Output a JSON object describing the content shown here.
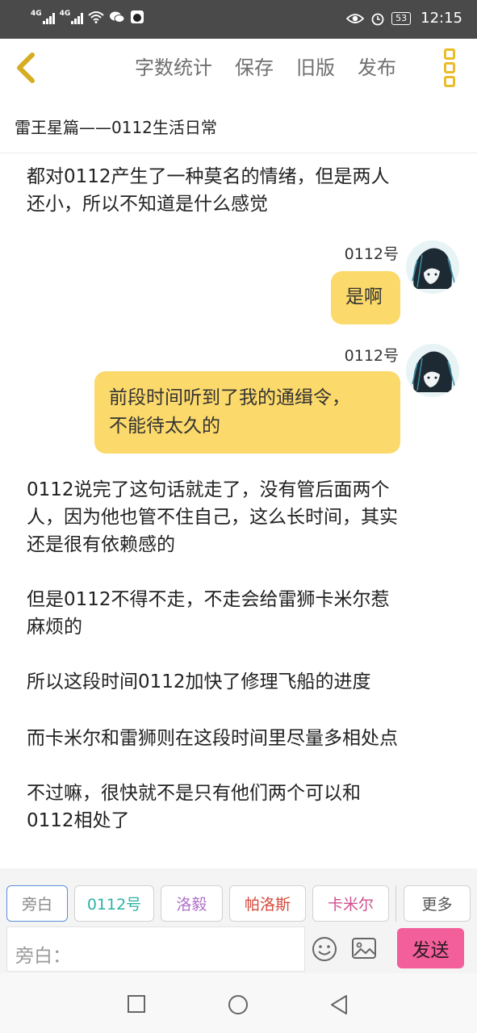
{
  "status_bar": {
    "signal1": "4G",
    "signal2": "4G",
    "battery": "53",
    "time": "12:15",
    "icons": [
      "signal-4g-icon",
      "wifi-icon",
      "wechat-icon",
      "app-icon",
      "eye-icon",
      "alarm-icon",
      "battery-icon"
    ]
  },
  "toolbar": {
    "back_icon": "chevron-left-icon",
    "word_count": "字数统计",
    "save": "保存",
    "old_version": "旧版",
    "publish": "发布",
    "more_icon": "more-vertical-icon"
  },
  "title": "雷王星篇——0112生活日常",
  "content": {
    "top_paragraph_lines": [
      "都对0112产生了一种莫名的情绪，但是两人",
      "还小，所以不知道是什么感觉"
    ],
    "messages": [
      {
        "speaker": "0112号",
        "text": "是啊"
      },
      {
        "speaker": "0112号",
        "text_lines": [
          "前段时间听到了我的通缉令，",
          "不能待太久的"
        ]
      }
    ],
    "paragraphs": [
      [
        "0112说完了这句话就走了，没有管后面两个",
        "人，因为他也管不住自己，这么长时间，其实",
        "还是很有依赖感的"
      ],
      [
        "但是0112不得不走，不走会给雷狮卡米尔惹",
        "麻烦的"
      ],
      [
        "所以这段时间0112加快了修理飞船的进度"
      ],
      [
        "而卡米尔和雷狮则在这段时间里尽量多相处点"
      ],
      [
        "不过嘛，很快就不是只有他们两个可以和",
        "0112相处了"
      ]
    ]
  },
  "characters": [
    {
      "label": "旁白",
      "color": "#8a8a8a"
    },
    {
      "label": "0112号",
      "color": "#2bb3a3"
    },
    {
      "label": "洛毅",
      "color": "#b071c9"
    },
    {
      "label": "帕洛斯",
      "color": "#d6493b"
    },
    {
      "label": "卡米尔",
      "color": "#d0508e"
    },
    {
      "label": "更多",
      "color": "#555555"
    }
  ],
  "input": {
    "placeholder": "旁白：",
    "emoji_icon": "emoji-icon",
    "image_icon": "image-icon",
    "send": "发送"
  },
  "navbar": [
    "recent-apps-icon",
    "home-icon",
    "back-icon"
  ]
}
